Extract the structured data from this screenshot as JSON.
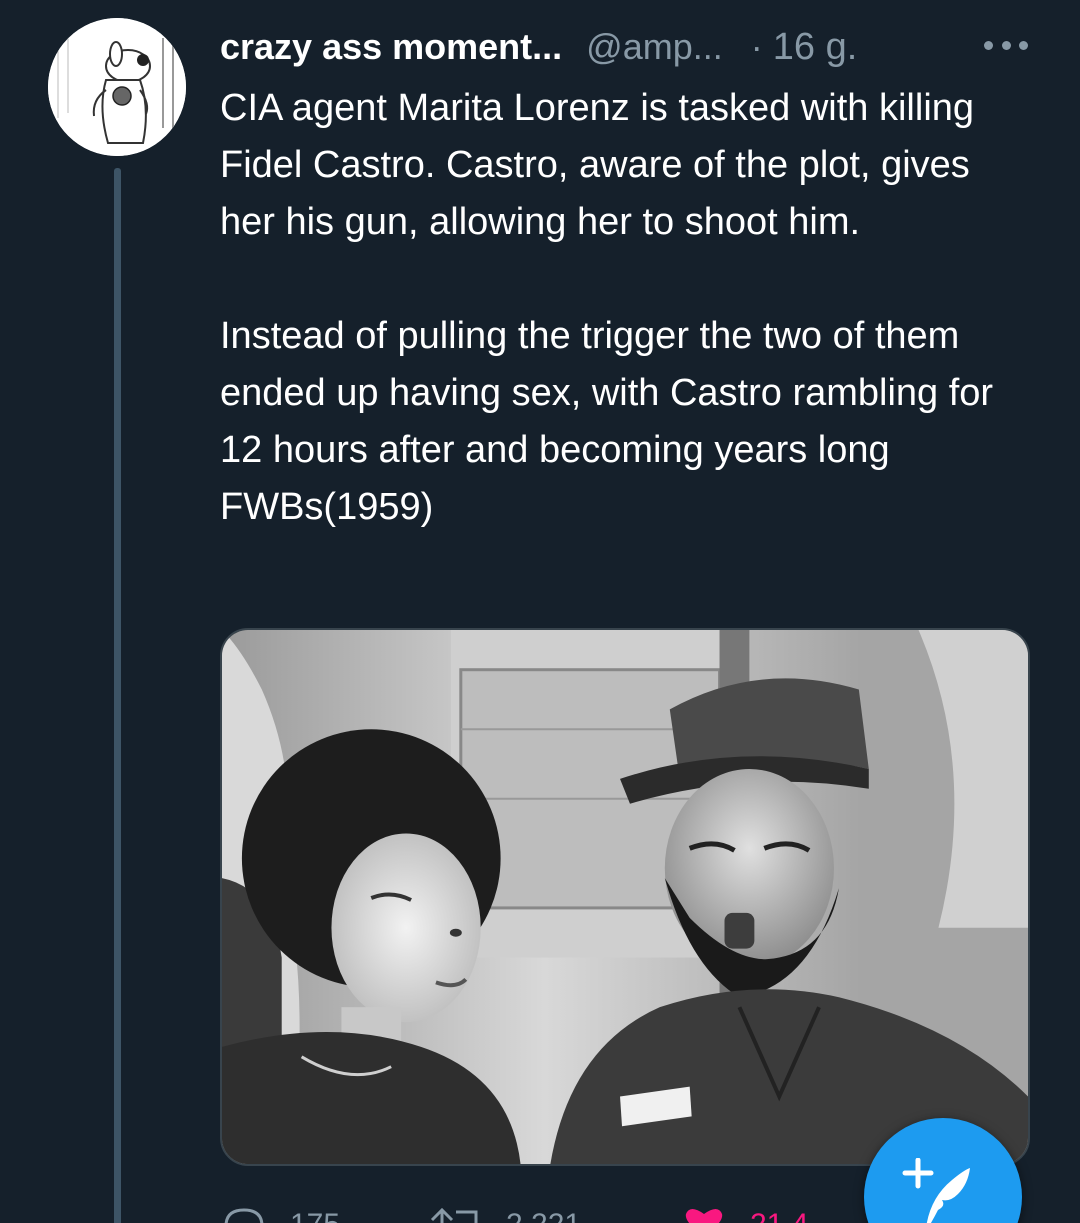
{
  "tweet": {
    "display_name": "crazy ass moment...",
    "handle": "@amp...",
    "separator": "·",
    "time": "16 g.",
    "text_paragraph_1": "CIA agent Marita Lorenz is tasked with killing Fidel Castro. Castro, aware of the plot, gives her his gun, allowing her to shoot him.",
    "text_paragraph_2": "Instead of pulling the trigger the two of them ended up having sex, with Castro rambling for 12 hours after and becoming years long FWBs(1959)"
  },
  "icons": {
    "more": "more-horizontal-icon",
    "reply": "reply-icon",
    "retweet": "retweet-icon",
    "like": "heart-icon",
    "compose": "compose-tweet-icon"
  },
  "actions": {
    "reply_count": "175",
    "retweet_count": "2.221",
    "like_count": "21.4"
  },
  "colors": {
    "background": "#15202b",
    "secondary_text": "#8899a6",
    "accent": "#1d9bf0",
    "like": "#f91880",
    "thread_line": "#3d5466"
  }
}
